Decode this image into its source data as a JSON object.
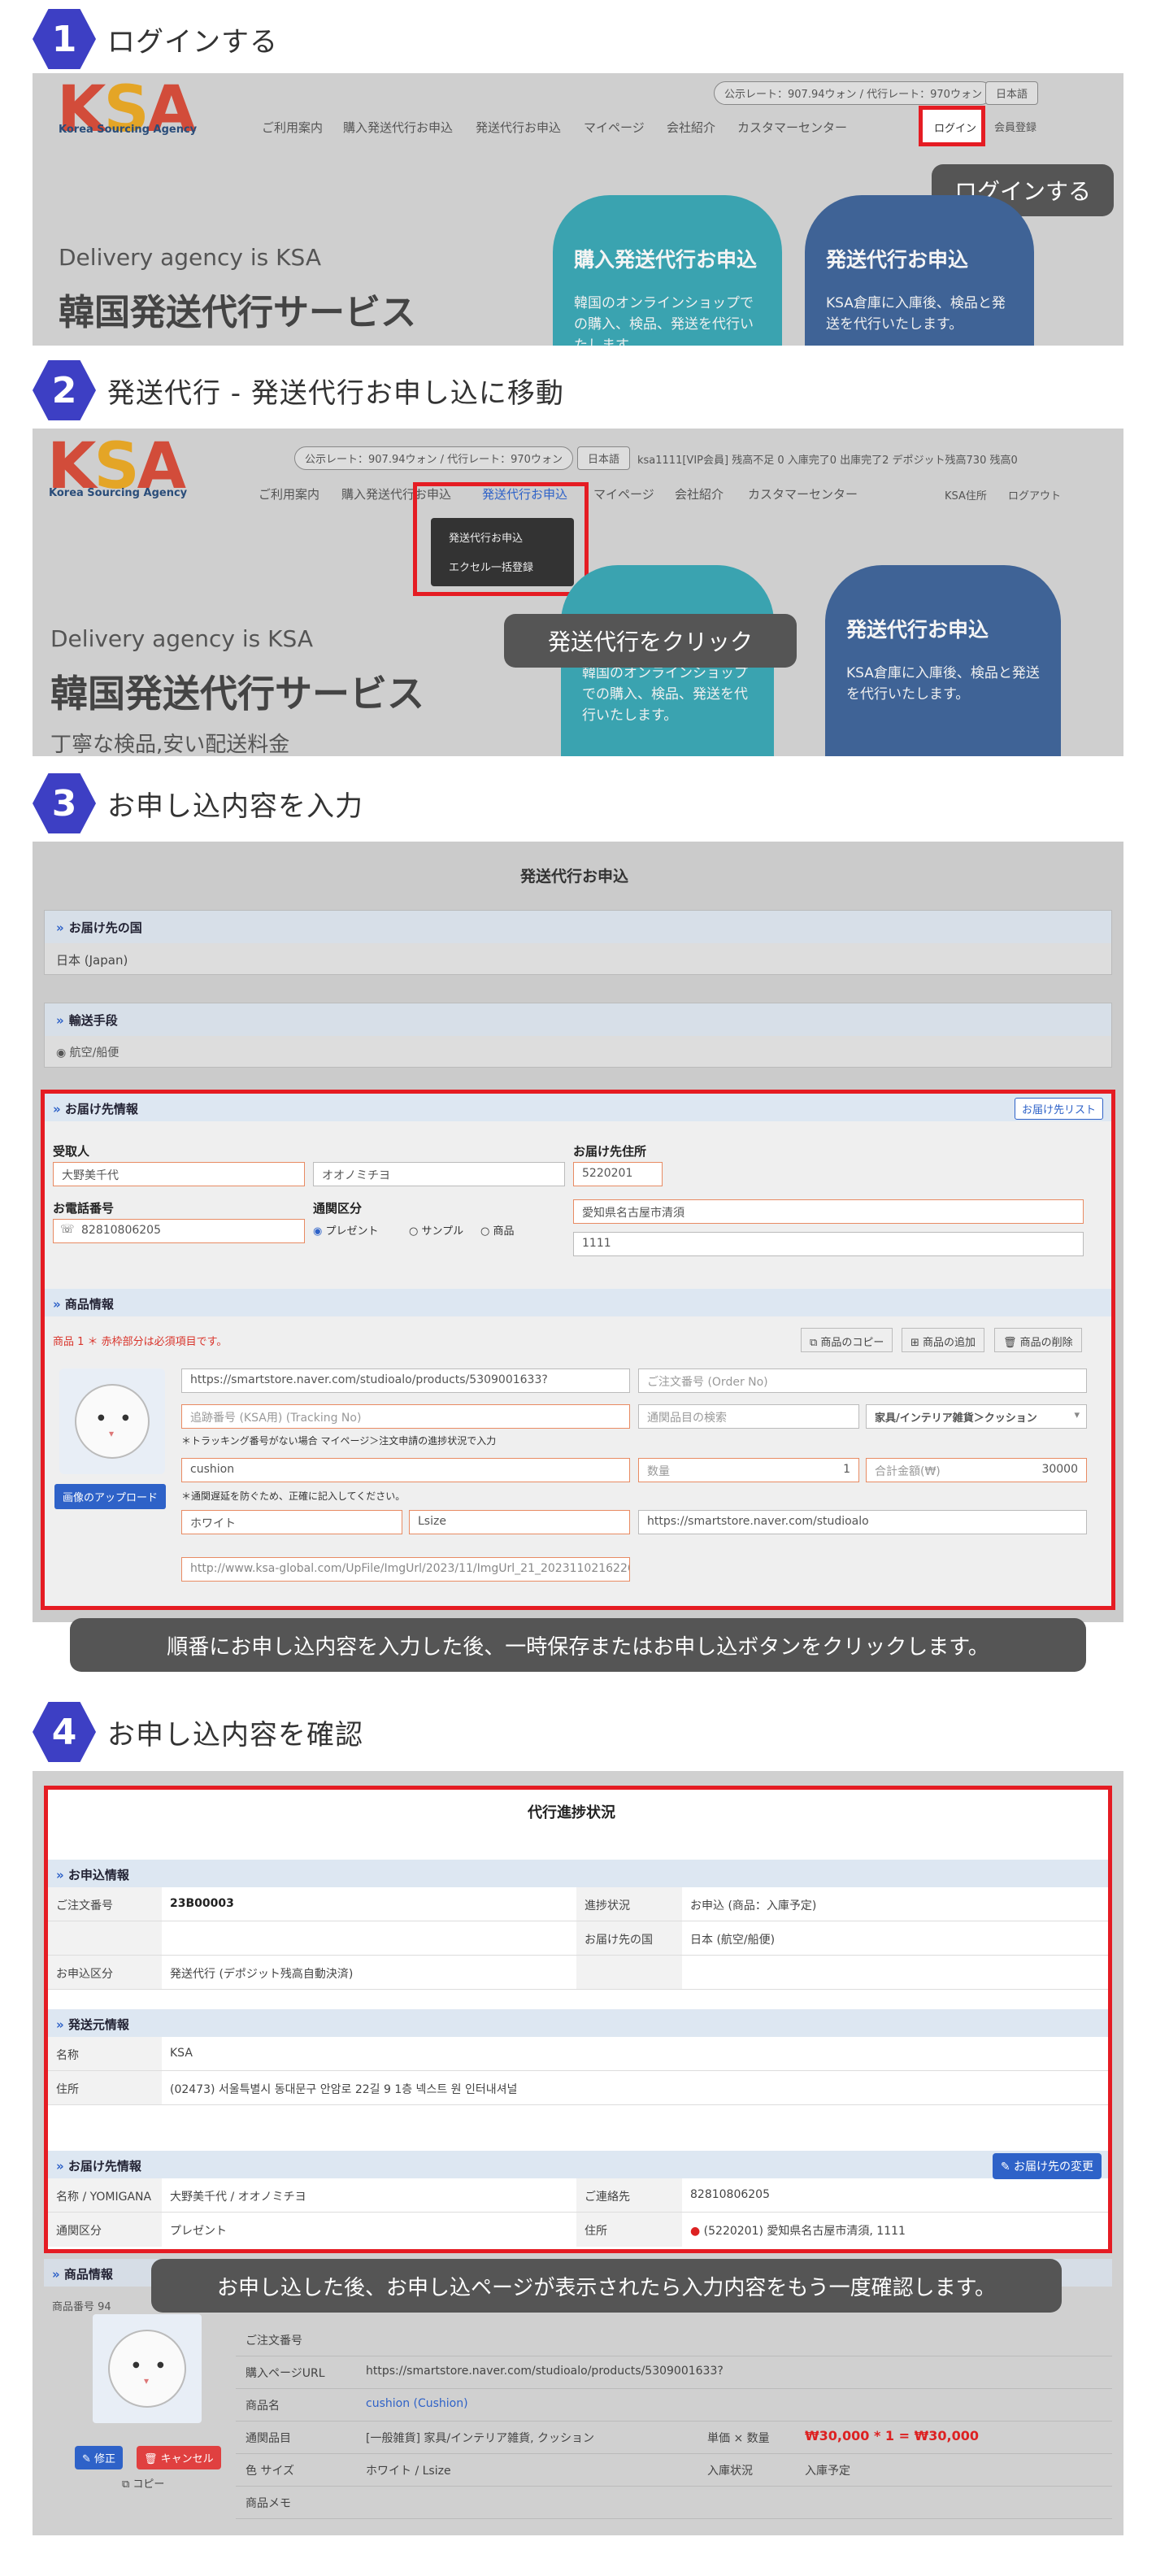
{
  "steps": [
    {
      "number": "1",
      "title": "ログインする"
    },
    {
      "number": "2",
      "title": "発送代行 - 発送代行お申し込に移動"
    },
    {
      "number": "3",
      "title": "お申し込内容を入力"
    },
    {
      "number": "4",
      "title": "お申し込内容を確認"
    }
  ],
  "brand": {
    "logo": "KSA",
    "logo_sub": "Korea Sourcing Agency"
  },
  "shot1": {
    "rate_pill": "公示レート：907.94ウォン / 代行レート：970ウォン",
    "lang": "日本語",
    "menu": [
      "ご利用案内",
      "購入発送代行お申込",
      "発送代行お申込",
      "マイページ",
      "会社紹介",
      "カスタマーセンター"
    ],
    "login": "ログイン",
    "register": "会員登録",
    "tooltip": "ログインする",
    "hero_en": "Delivery agency is KSA",
    "hero_jp": "韓国発送代行サービス",
    "card1_title": "購入発送代行お申込",
    "card1_desc": "韓国のオンラインショップでの購入、検品、発送を代行いたします。",
    "card2_title": "発送代行お申込",
    "card2_desc": "KSA倉庫に入庫後、検品と発送を代行いたします。"
  },
  "shot2": {
    "rate_pill": "公示レート：907.94ウォン / 代行レート：970ウォン",
    "lang": "日本語",
    "user_status": "ksa1111[VIP会員]  残高不足 0  入庫完了0  出庫完了2  デポジット残高730  残高0",
    "menu": [
      "ご利用案内",
      "購入発送代行お申込",
      "発送代行お申込",
      "マイページ",
      "会社紹介",
      "カスタマーセンター"
    ],
    "right_links": [
      "KSA住所",
      "ログアウト"
    ],
    "dropdown": [
      "発送代行お申込",
      "エクセル一括登録"
    ],
    "tooltip": "発送代行をクリック",
    "hero_en": "Delivery agency is KSA",
    "hero_jp": "韓国発送代行サービス",
    "hero_sub": "丁寧な検品,安い配送料金",
    "card1_desc": "韓国のオンラインショップでの購入、検品、発送を代行いたします。",
    "card2_title": "発送代行お申込",
    "card2_desc": "KSA倉庫に入庫後、検品と発送を代行いたします。"
  },
  "shot3": {
    "page_title": "発送代行お申込",
    "dest_country_h": "お届け先の国",
    "dest_country": "日本 (Japan)",
    "transport_h": "輸送手段",
    "transport": "航空/船便",
    "recipient_h": "お届け先情報",
    "recipient_list_btn": "お届け先リスト",
    "name_label": "受取人",
    "name_value": "大野美千代",
    "name_kana": "オオノミチヨ",
    "address_label": "お届け先住所",
    "zip": "5220201",
    "address1": "愛知県名古屋市清須",
    "address2": "1111",
    "phone_label": "お電話番号",
    "phone": "82810806205",
    "customs_label": "通関区分",
    "customs_options": [
      "プレゼント",
      "サンプル",
      "商品"
    ],
    "product_h": "商品情報",
    "product_note": "商品 1 ＊ 赤枠部分は必須項目です。",
    "copy_btn": "商品のコピー",
    "add_btn": "商品の追加",
    "delete_btn": "商品の削除",
    "upload_btn": "画像のアップロード",
    "url": "https://smartstore.naver.com/studioalo/products/5309001633?",
    "order_no": "ご注文番号 (Order No)",
    "tracking": "追跡番号 (KSA用) (Tracking No)",
    "tracking_note": "＊トラッキング番号がない場合 マイページ＞注文申請の進捗状況で入力",
    "category_search": "通関品目の検索",
    "category": "家具/インテリア雑貨＞クッション",
    "item_name": "cushion",
    "qty_label": "数量",
    "qty": "1",
    "total_label": "合計金額(₩)",
    "total": "30000",
    "customs_note": "＊通関遅延を防ぐため、正確に記入してください。",
    "color": "ホワイト",
    "size": "Lsize",
    "shop_url": "https://smartstore.naver.com/studioalo",
    "image_url": "http://www.ksa-global.com/UpFile/ImgUrl/2023/11/ImgUrl_21_2023110216226x",
    "tooltip": "順番にお申し込内容を入力した後、一時保存またはお申し込ボタンをクリックします。"
  },
  "shot4": {
    "page_title": "代行進捗状況",
    "apply_h": "お申込情報",
    "order_no_label": "ご注文番号",
    "order_no": "23B00003",
    "progress_label": "進捗状況",
    "progress": "お申込 (商品：入庫予定)",
    "dest_country_label": "お届け先の国",
    "dest_country": "日本 (航空/船便)",
    "apply_type_label": "お申込区分",
    "apply_type": "発送代行 (デポジット残高自動決済)",
    "sender_h": "発送元情報",
    "sender_name_label": "名称",
    "sender_name": "KSA",
    "sender_addr_label": "住所",
    "sender_addr": "(02473) 서울특별시 동대문구 안암로 22길 9 1층 넥스트 원 인터내셔널",
    "recipient_h": "お届け先情報",
    "change_btn": "お届け先の変更",
    "rname_label": "名称 / YOMIGANA",
    "rname": "大野美千代 / オオノミチヨ",
    "contact_label": "ご連絡先",
    "contact": "82810806205",
    "customs_label": "通関区分",
    "customs": "プレゼント",
    "raddr_label": "住所",
    "raddr": "(5220201) 愛知県名古屋市清須, 1111",
    "product_h": "商品情報",
    "product_no": "商品番号 94",
    "edit_btn": "修正",
    "cancel_btn": "キャンセル",
    "copy_btn": "コピー",
    "detail_rows": [
      {
        "label": "ご注文番号",
        "value": ""
      },
      {
        "label": "購入ページURL",
        "value": "https://smartstore.naver.com/studioalo/products/5309001633?"
      },
      {
        "label": "商品名",
        "value": "cushion (Cushion)"
      }
    ],
    "category_label": "通関品目",
    "category": "[一般雑貨] 家具/インテリア雑貨, クッション",
    "unit_label": "単価 × 数量",
    "unit_value": "₩30,000  *  1 = ₩30,000",
    "colorsize_label": "色 サイズ",
    "colorsize": "ホワイト / Lsize",
    "stock_label": "入庫状況",
    "stock": "入庫予定",
    "memo_label": "商品メモ",
    "tooltip": "お申し込した後、お申し込ページが表示されたら入力内容をもう一度確認します。"
  }
}
